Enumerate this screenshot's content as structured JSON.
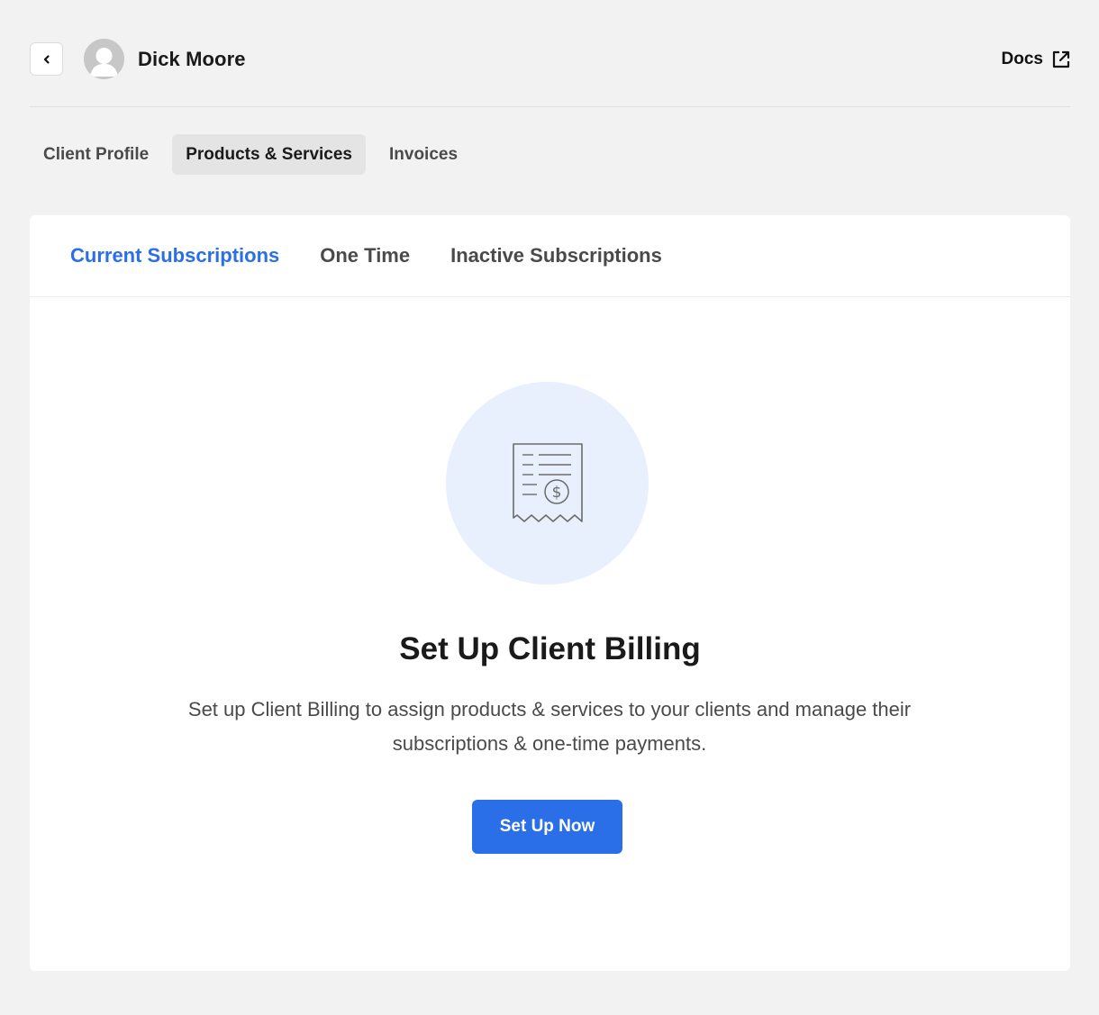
{
  "header": {
    "client_name": "Dick Moore",
    "docs_label": "Docs"
  },
  "top_tabs": [
    {
      "label": "Client Profile",
      "active": false
    },
    {
      "label": "Products & Services",
      "active": true
    },
    {
      "label": "Invoices",
      "active": false
    }
  ],
  "sub_tabs": [
    {
      "label": "Current Subscriptions",
      "active": true
    },
    {
      "label": "One Time",
      "active": false
    },
    {
      "label": "Inactive Subscriptions",
      "active": false
    }
  ],
  "empty_state": {
    "icon": "receipt-dollar-icon",
    "title": "Set Up Client Billing",
    "description": "Set up Client Billing to assign products & services to your clients and manage their subscriptions & one-time payments.",
    "button_label": "Set Up Now"
  },
  "colors": {
    "accent": "#2a6ee8",
    "background": "#f2f2f2",
    "illustration_bg": "#e8f0fd"
  }
}
